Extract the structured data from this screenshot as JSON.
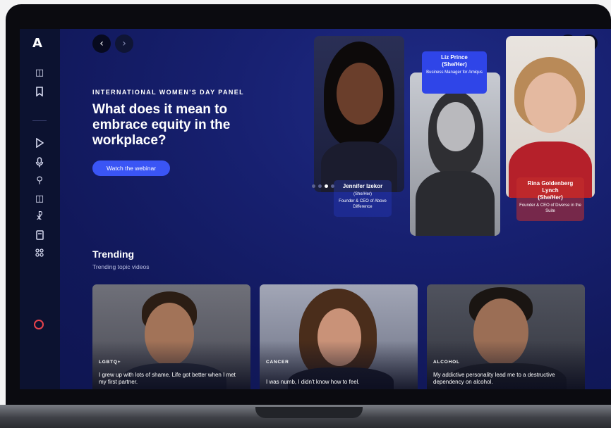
{
  "app": {
    "logo_text": "A"
  },
  "sidebar": {
    "icons": [
      "layers-icon",
      "bookmark-icon",
      "play-icon",
      "microphone-icon",
      "podcast-icon",
      "courses-icon",
      "certificate-icon",
      "book-icon",
      "apps-icon",
      "user-icon"
    ]
  },
  "nav": {
    "back": "‹",
    "forward": "›"
  },
  "hero": {
    "eyebrow": "INTERNATIONAL WOMEN'S DAY PANEL",
    "headline": "What does it mean to embrace equity in the workplace?",
    "cta": "Watch the webinar",
    "slide_active": 3,
    "panelists": [
      {
        "name": "Jennifer Izekor",
        "name_shown": "Jennifer Izekor",
        "pronouns": "(She/Her)",
        "role": "Founder & CEO of Above Difference"
      },
      {
        "name": "Liz Prince",
        "pronouns": "(She/Her)",
        "role": "Business Manager for Amiqus"
      },
      {
        "name": "Rina Goldenberg Lynch",
        "pronouns": "(She/Her)",
        "role": "Founder & CEO of Diverse in the Suite"
      }
    ]
  },
  "trending": {
    "title": "Trending",
    "subtitle": "Trending topic videos",
    "videos": [
      {
        "tag": "LGBTQ+",
        "quote": "I grew up with lots of shame. Life got better when I met my first partner."
      },
      {
        "tag": "CANCER",
        "quote": "I was numb, I didn't know how to feel."
      },
      {
        "tag": "ALCOHOL",
        "quote": "My addictive personality lead me to a destructive dependency on alcohol."
      }
    ]
  },
  "colors": {
    "accent": "#3a55f5",
    "bg": "#172070",
    "sidebar": "#0c1230",
    "tag_blue": "#2f45e8",
    "tag_red": "#c4302b"
  }
}
